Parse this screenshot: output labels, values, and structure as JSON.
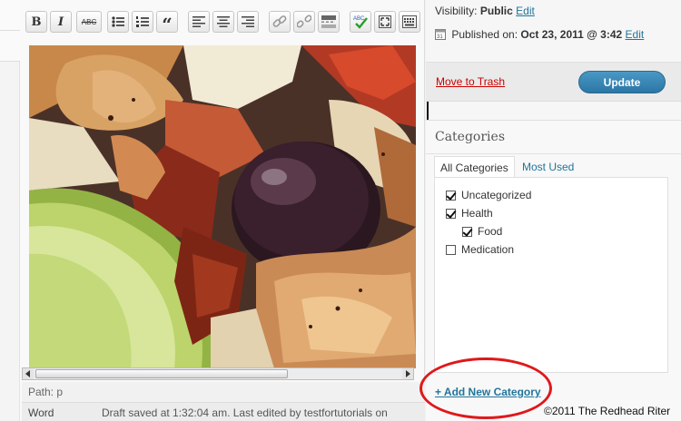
{
  "toolbar": {
    "bold_label": "B",
    "italic_label": "I",
    "strike_label": "ABC",
    "quote_label": "“",
    "spellcheck_label": "ABC",
    "buttons": [
      "bold",
      "italic",
      "strikethrough",
      "bullet-list",
      "numbered-list",
      "blockquote",
      "align-left",
      "align-center",
      "align-right",
      "insert-link",
      "remove-link",
      "insert-more",
      "spellcheck",
      "fullscreen",
      "kitchen-sink"
    ]
  },
  "editor": {
    "path_label": "Path: p",
    "word_label": "Word",
    "draft_status": "Draft saved at 1:32:04 am. Last edited by testfortutorials on"
  },
  "publish": {
    "visibility_label": "Visibility:",
    "visibility_value": "Public",
    "visibility_edit": "Edit",
    "published_label": "Published on:",
    "published_value": "Oct 23, 2011 @ 3:42",
    "published_edit": "Edit",
    "trash_label": "Move to Trash",
    "update_label": "Update"
  },
  "categories": {
    "title": "Categories",
    "tabs": [
      {
        "label": "All Categories",
        "active": true
      },
      {
        "label": "Most Used",
        "active": false
      }
    ],
    "items": [
      {
        "label": "Uncategorized",
        "checked": true,
        "indent": 0
      },
      {
        "label": "Health",
        "checked": true,
        "indent": 0
      },
      {
        "label": "Food",
        "checked": true,
        "indent": 1
      },
      {
        "label": "Medication",
        "checked": false,
        "indent": 0
      }
    ],
    "add_new_label": "+ Add New Category"
  },
  "copyright": "©2011 The Redhead Riter",
  "colors": {
    "link": "#21759b",
    "trash": "#cc0000",
    "update_button": "#2b76a6",
    "highlight_oval": "#e0181b"
  }
}
